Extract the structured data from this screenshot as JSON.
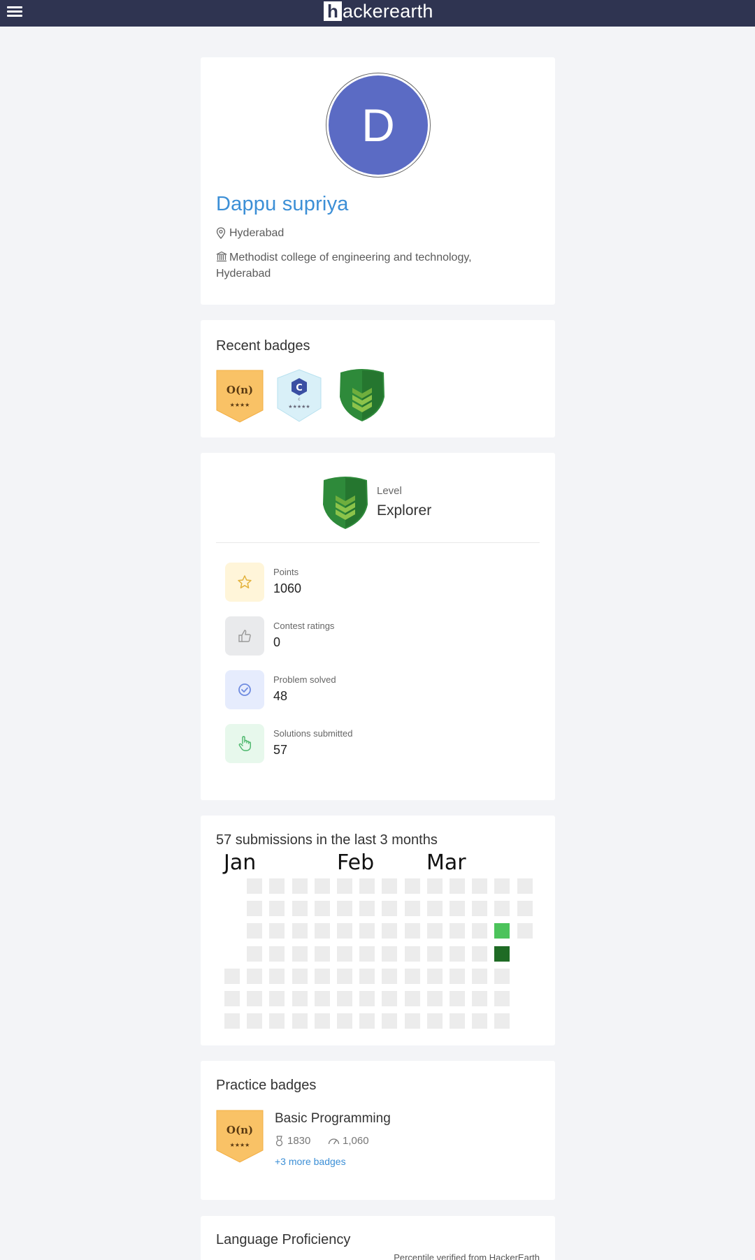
{
  "header": {
    "logo_box": "h",
    "logo_text": "ackerearth"
  },
  "profile": {
    "avatar_initial": "D",
    "name": "Dappu supriya",
    "location": "Hyderabad",
    "institution_line1": "Methodist college of engineering and technology,",
    "institution_line2": "Hyderabad"
  },
  "recent_badges": {
    "title": "Recent badges",
    "items": [
      {
        "icon": "complexity-badge-icon",
        "text": "O(n)",
        "stars": "★★★★",
        "color": "#f9c266"
      },
      {
        "icon": "c-language-badge-icon",
        "text": "C",
        "stars": "★★★★★",
        "color": "#d8eef7"
      },
      {
        "icon": "explorer-level-badge-icon",
        "color": "#2e8a3a"
      }
    ]
  },
  "level": {
    "label": "Level",
    "value": "Explorer"
  },
  "stats": [
    {
      "label": "Points",
      "value": "1060",
      "icon": "star-icon",
      "bg": "#fff5d9",
      "fg": "#e3b23c"
    },
    {
      "label": "Contest ratings",
      "value": "0",
      "icon": "thumbs-up-icon",
      "bg": "#e9eaec",
      "fg": "#999999"
    },
    {
      "label": "Problem solved",
      "value": "48",
      "icon": "check-circle-icon",
      "bg": "#e6ecfd",
      "fg": "#6f8be0"
    },
    {
      "label": "Solutions submitted",
      "value": "57",
      "icon": "pointer-hand-icon",
      "bg": "#e7f8ec",
      "fg": "#4ab66a"
    }
  ],
  "activity": {
    "title": "57 submissions in the last 3 months",
    "months": [
      "Jan",
      "Feb",
      "Mar"
    ],
    "colors": {
      "empty": "#ececec",
      "light": "#4cc35b",
      "dark": "#1f6b25"
    }
  },
  "practice_badges": {
    "title": "Practice badges",
    "badge_text": "O(n)",
    "badge_stars": "★★★★",
    "name": "Basic Programming",
    "rank": "1830",
    "score": "1,060",
    "more": "+3 more badges"
  },
  "language": {
    "title": "Language Proficiency",
    "note": "Percentile verified from HackerEarth"
  }
}
